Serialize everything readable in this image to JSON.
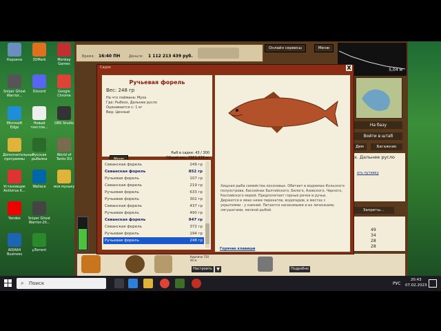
{
  "desktop_icons": [
    {
      "label": "Корзина",
      "icon": "recycle-bin-icon"
    },
    {
      "label": "3DMark",
      "icon": "3dmark-icon"
    },
    {
      "label": "Monkey Games",
      "icon": "monkey-games-icon"
    },
    {
      "label": "Sniper Ghost Warrior...",
      "icon": "sniper-ghost-warrior-icon"
    },
    {
      "label": "Discord",
      "icon": "discord-icon"
    },
    {
      "label": "Google Chrome",
      "icon": "chrome-icon"
    },
    {
      "label": "Microsoft Edge",
      "icon": "edge-icon"
    },
    {
      "label": "Новый текстов...",
      "icon": "text-file-icon"
    },
    {
      "label": "OBS Studio",
      "icon": "obs-icon"
    },
    {
      "label": "Дополнительные программы",
      "icon": "folder-icon"
    },
    {
      "label": "Русская рыбалка",
      "icon": "russian-fishing-icon"
    },
    {
      "label": "World of Tanks EU",
      "icon": "world-of-tanks-icon"
    },
    {
      "label": "Установщик Antivirus K...",
      "icon": "antivirus-installer-icon"
    },
    {
      "label": "Wallace",
      "icon": "wallace-icon"
    },
    {
      "label": "моя музыку",
      "icon": "folder-music-icon"
    },
    {
      "label": "Yandex",
      "icon": "yandex-icon"
    },
    {
      "label": "Sniper Ghost Warrior-20...",
      "icon": "sniper-ghost-warrior-2-icon"
    },
    {
      "label": "AIDA64 Business",
      "icon": "aida64-icon"
    },
    {
      "label": "µTorrent",
      "icon": "utorrent-icon"
    }
  ],
  "game": {
    "time_label": "Время:",
    "time_value": "16:40 ПН",
    "money_label": "Деньги:",
    "money_value": "1 112 213 439 руб.",
    "online_services": "Онлайн сервисы",
    "menu": "Меню",
    "depth": "5,04 м",
    "to_base": "На базу",
    "go_to_hq": "Войти в штаб",
    "day": "Дем",
    "trunk": "Багажник",
    "location": "х. Дальнее русло",
    "route_link": "ать путевку",
    "permits": "Запреты...",
    "numbers": [
      "49",
      "34",
      "28",
      "28"
    ],
    "setup": "Настроить",
    "details": "Подробно",
    "item_text": "Кирпичи 750 40 м"
  },
  "dialog": {
    "title": "Садок",
    "close": "X",
    "fish_name": "Ручьевая форель",
    "weight": "Вес: 248 гр",
    "bait": "На что поймана: Муха",
    "where": "Где: Рыбхоз, Дальнее русло",
    "value": "Оценивается с: 1 кг",
    "type": "Вид: Ценный",
    "menu_button": "Меню",
    "fish_count": "Рыб в садке: 43 / 300",
    "total_weight": "Общий вес: 2863,938 кг",
    "description": "Хищная рыба семейства лососевых. Обитает в водоемах Кольского полуострова, бассейнах Балтийского, Белого, Азовского, Черного, Каспийского морей. Предпочитает горные речки и ручьи. Держится в ямах ниже перекатов, водопадов, в местах с укрытиями - у камней. Питается насекомыми и их личинками, лягушатами, мелкой рыбой.",
    "hotkeys": "Горячие клавиши",
    "fish_list": [
      {
        "name": "Севанская форель",
        "weight": "249 гр",
        "bold": false,
        "selected": false
      },
      {
        "name": "Севанская форель",
        "weight": "852 гр",
        "bold": true,
        "selected": false
      },
      {
        "name": "Ручьевая форель",
        "weight": "107 гр",
        "bold": false,
        "selected": false
      },
      {
        "name": "Севанская форель",
        "weight": "219 гр",
        "bold": false,
        "selected": false
      },
      {
        "name": "Ручьевая форель",
        "weight": "633 гр",
        "bold": false,
        "selected": false
      },
      {
        "name": "Ручьевая форель",
        "weight": "302 гр",
        "bold": false,
        "selected": false
      },
      {
        "name": "Севанская форель",
        "weight": "437 гр",
        "bold": false,
        "selected": false
      },
      {
        "name": "Ручьевая форель",
        "weight": "490 гр",
        "bold": false,
        "selected": false
      },
      {
        "name": "Севанская форель",
        "weight": "947 гр",
        "bold": true,
        "selected": false
      },
      {
        "name": "Севанская форель",
        "weight": "372 гр",
        "bold": false,
        "selected": false
      },
      {
        "name": "Ручьевая форель",
        "weight": "194 гр",
        "bold": false,
        "selected": false
      },
      {
        "name": "Ручьевая форель",
        "weight": "248 гр",
        "bold": false,
        "selected": true
      }
    ]
  },
  "taskbar": {
    "search": "Поиск",
    "time": "20:43",
    "date": "07.02.2023",
    "lang": "РУС"
  }
}
